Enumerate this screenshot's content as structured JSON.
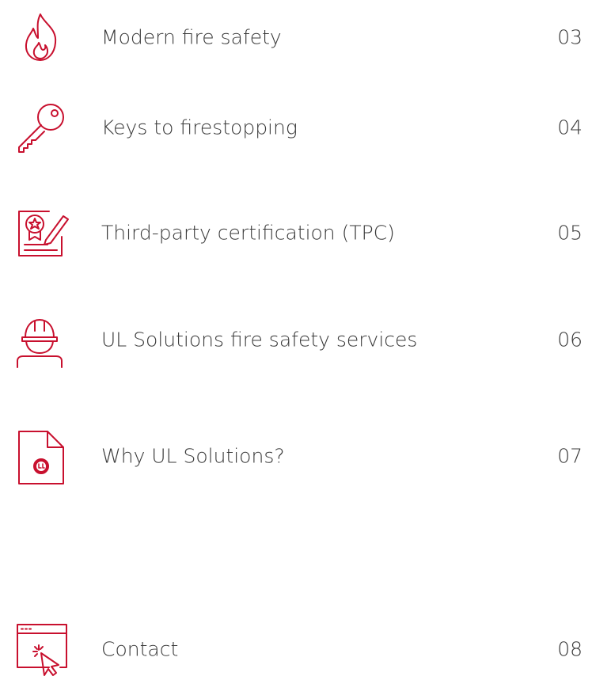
{
  "accent_color": "#c8102e",
  "toc": {
    "entries": [
      {
        "title": "Modern fire safety",
        "page": "03",
        "icon": "flame-icon"
      },
      {
        "title": "Keys to firestopping",
        "page": "04",
        "icon": "key-icon"
      },
      {
        "title": "Third-party certification (TPC)",
        "page": "05",
        "icon": "certificate-icon"
      },
      {
        "title": "UL Solutions fire safety services",
        "page": "06",
        "icon": "hard-hat-worker-icon"
      },
      {
        "title": "Why UL Solutions?",
        "page": "07",
        "icon": "ul-document-icon"
      },
      {
        "title": "Contact",
        "page": "08",
        "icon": "browser-click-icon"
      }
    ]
  }
}
